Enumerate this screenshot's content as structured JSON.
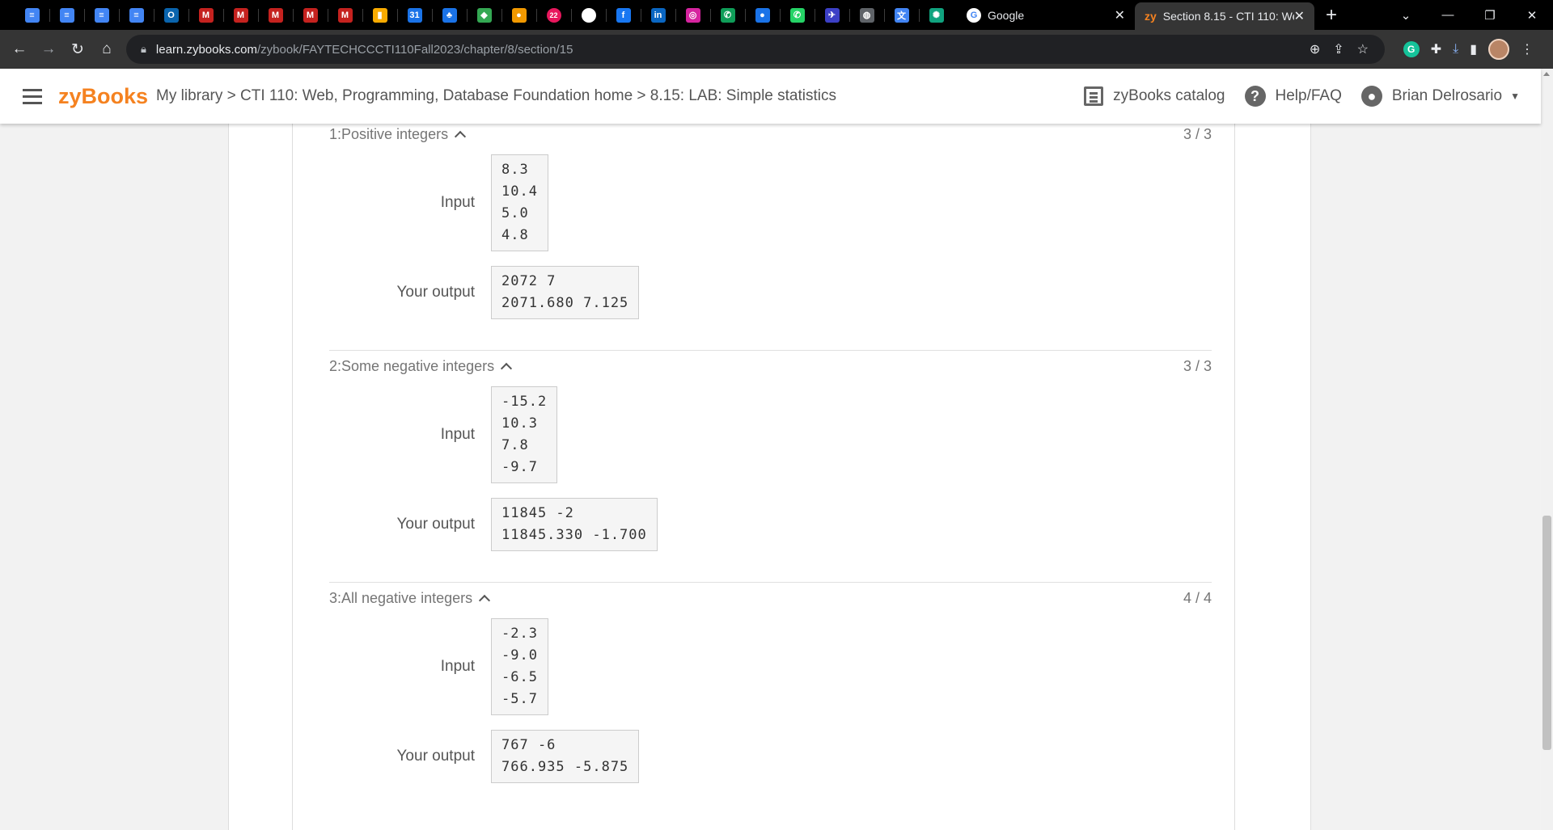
{
  "browser": {
    "pinned_tabs": [
      {
        "icon": "google-docs-icon",
        "color": "#4285f4",
        "glyph": "≡"
      },
      {
        "icon": "google-docs-icon",
        "color": "#4285f4",
        "glyph": "≡"
      },
      {
        "icon": "google-docs-icon",
        "color": "#4285f4",
        "glyph": "≡"
      },
      {
        "icon": "google-docs-icon",
        "color": "#4285f4",
        "glyph": "≡"
      },
      {
        "icon": "outlook-icon",
        "color": "#0a64ad",
        "glyph": "O"
      },
      {
        "icon": "gmail-icon",
        "color": "#c5221f",
        "glyph": "M"
      },
      {
        "icon": "gmail-icon",
        "color": "#c5221f",
        "glyph": "M"
      },
      {
        "icon": "gmail-icon",
        "color": "#c5221f",
        "glyph": "M"
      },
      {
        "icon": "gmail-icon",
        "color": "#c5221f",
        "glyph": "M"
      },
      {
        "icon": "gmail-icon",
        "color": "#c5221f",
        "glyph": "M"
      },
      {
        "icon": "bar-chart-icon",
        "color": "#f9ab00",
        "glyph": "▮"
      },
      {
        "icon": "google-calendar-icon",
        "color": "#1a73e8",
        "glyph": "31"
      },
      {
        "icon": "people-icon",
        "color": "#1a73e8",
        "glyph": "♣"
      },
      {
        "icon": "google-maps-icon",
        "color": "#34a853",
        "glyph": "◆"
      },
      {
        "icon": "app-icon-orange",
        "color": "#f29900",
        "glyph": "●"
      },
      {
        "icon": "notification-badge-icon",
        "color": "#e8175d",
        "glyph": "22"
      },
      {
        "icon": "white-circle-icon",
        "color": "#ffffff",
        "glyph": ""
      },
      {
        "icon": "facebook-icon",
        "color": "#1877f2",
        "glyph": "f"
      },
      {
        "icon": "linkedin-icon",
        "color": "#0a66c2",
        "glyph": "in"
      },
      {
        "icon": "instagram-icon",
        "color": "#d6249f",
        "glyph": "◎"
      },
      {
        "icon": "phone-icon",
        "color": "#0f9d58",
        "glyph": "✆"
      },
      {
        "icon": "chat-bubble-icon",
        "color": "#1a73e8",
        "glyph": "●"
      },
      {
        "icon": "whatsapp-icon",
        "color": "#25d366",
        "glyph": "✆"
      },
      {
        "icon": "plane-icon",
        "color": "#3c40c6",
        "glyph": "✈"
      },
      {
        "icon": "globe-icon",
        "color": "#5f6368",
        "glyph": "◍"
      },
      {
        "icon": "translate-icon",
        "color": "#4285f4",
        "glyph": "文"
      },
      {
        "icon": "chatgpt-icon",
        "color": "#10a37f",
        "glyph": "✺"
      }
    ],
    "tabs": [
      {
        "title": "Google",
        "close": "✕"
      },
      {
        "title": "Section 8.15 - CTI 110: We",
        "close": "✕",
        "favicon": "zy"
      }
    ],
    "url_host": "learn.zybooks.com",
    "url_path": "/zybook/FAYTECHCCCTI110Fall2023/chapter/8/section/15"
  },
  "header": {
    "logo": "zyBooks",
    "breadcrumb": "My library > CTI 110: Web, Programming, Database Foundation home > 8.15: LAB: Simple statistics",
    "catalog": "zyBooks catalog",
    "help": "Help/FAQ",
    "help_glyph": "?",
    "user": "Brian Delrosario"
  },
  "labels": {
    "input": "Input",
    "output": "Your output"
  },
  "tests": [
    {
      "title": "1:Positive integers",
      "score": "3 / 3",
      "input": "8.3\n10.4\n5.0\n4.8",
      "output": "2072 7\n2071.680 7.125"
    },
    {
      "title": "2:Some negative integers",
      "score": "3 / 3",
      "input": "-15.2\n10.3\n7.8\n-9.7",
      "output": "11845 -2\n11845.330 -1.700"
    },
    {
      "title": "3:All negative integers",
      "score": "4 / 4",
      "input": "-2.3\n-9.0\n-6.5\n-5.7",
      "output": "767 -6\n766.935 -5.875"
    }
  ]
}
